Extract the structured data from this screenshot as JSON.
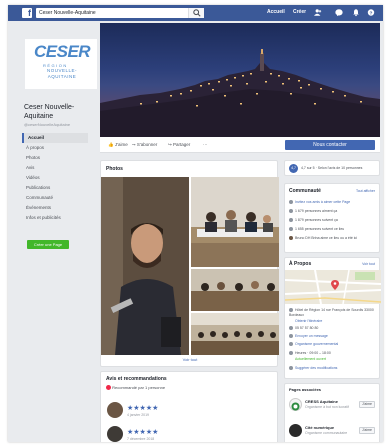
{
  "topbar": {
    "search_value": "Ceser Nouvelle-Aquitaine",
    "nav_home": "Accueil",
    "nav_create": "Créer"
  },
  "profile": {
    "logo_main": "CESER",
    "logo_region": "RÉGION",
    "logo_na": "NOUVELLE-AQUITAINE",
    "name": "Ceser Nouvelle-Aquitaine",
    "handle": "@ceserNouvelleAquitaine"
  },
  "left_nav": [
    {
      "label": "Accueil",
      "active": true
    },
    {
      "label": "À propos"
    },
    {
      "label": "Photos"
    },
    {
      "label": "Avis"
    },
    {
      "label": "Vidéos"
    },
    {
      "label": "Publications"
    },
    {
      "label": "Communauté"
    },
    {
      "label": "Événements"
    },
    {
      "label": "Infos et publicités"
    }
  ],
  "create_page_label": "Créer une Page",
  "actions": {
    "like": "J'aime",
    "follow": "S'abonner",
    "share": "Partager",
    "more": "···",
    "contact": "Nous contacter"
  },
  "photos": {
    "title": "Photos",
    "see_all": "Voir tout"
  },
  "reviews": {
    "title": "Avis et recommandations",
    "summary": "Recommandé par 1 personne",
    "items": [
      {
        "stars": "★★★★★",
        "date": "4 janvier 2019"
      },
      {
        "stars": "★★★★★",
        "date": "7 décembre 2018"
      }
    ]
  },
  "rating": {
    "score": "4,7",
    "text": "4,7 sur 5 · Selon l'avis de 10 personnes"
  },
  "community": {
    "title": "Communauté",
    "see_all": "Tout afficher",
    "rows": [
      "Invitez vos amis à aimer cette Page",
      "1 679 personnes aiment ça",
      "1 879 personnes suivent ça",
      "1 655 personnes suivent ce lieu",
      "Bruno DH Brina aime ce lieu ou a été ici"
    ]
  },
  "about": {
    "title": "À Propos",
    "see_all": "Voir tout",
    "rows": [
      "Hôtel de Région 14 rue François de Sourdis 33000 Bordeaux",
      "Obtenir l'itinéraire",
      "05 57 57 80 80",
      "Envoyer un message",
      "Organisme gouvernemental",
      "Heures · 09:00 – 18:00",
      "Actuellement ouvert",
      "Suggérer des modifications"
    ]
  },
  "related_pages": {
    "title": "Pages associées",
    "items": [
      {
        "name": "CRESS Aquitaine",
        "sub": "Organisme à but non lucratif",
        "button": "J'aime"
      },
      {
        "name": "Cité numérique",
        "sub": "Organisme communautaire",
        "button": "J'aime"
      }
    ]
  },
  "colors": {
    "fb_blue": "#3b5998",
    "link_blue": "#4267b2",
    "green": "#42b72a",
    "logo_blue": "#4a87c8"
  }
}
